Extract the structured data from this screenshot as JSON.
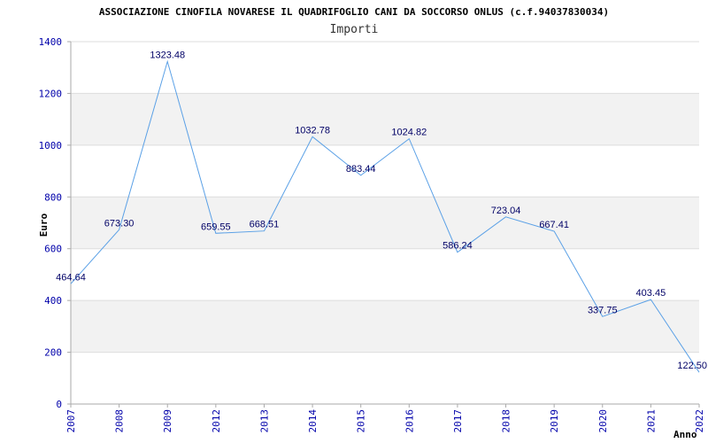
{
  "chart_data": {
    "type": "line",
    "title": "ASSOCIAZIONE CINOFILA NOVARESE IL QUADRIFOGLIO CANI DA SOCCORSO ONLUS (c.f.94037830034)",
    "subtitle": "Importi",
    "xlabel": "Anno",
    "ylabel": "Euro",
    "categories": [
      "2007",
      "2008",
      "2009",
      "2012",
      "2013",
      "2014",
      "2015",
      "2016",
      "2017",
      "2018",
      "2019",
      "2020",
      "2021",
      "2022"
    ],
    "series": [
      {
        "values": [
          464.64,
          673.3,
          1323.48,
          659.55,
          668.51,
          1032.78,
          883.44,
          1024.82,
          586.24,
          723.04,
          667.41,
          337.75,
          403.45,
          122.5
        ],
        "labels": [
          "464.64",
          "673.30",
          "1323.48",
          "659.55",
          "668.51",
          "1032.78",
          "883.44",
          "1024.82",
          "586.24",
          "723.04",
          "667.41",
          "337.75",
          "403.45",
          "122.50"
        ]
      }
    ],
    "ylim": [
      0,
      1400
    ],
    "yticks": [
      "0",
      "200",
      "400",
      "600",
      "800",
      "1000",
      "1200",
      "1400"
    ],
    "grid": true,
    "line_color": "#5aa0e6",
    "band_color": "#f2f2f2",
    "tick_color": "#0000aa",
    "label_color": "#000066"
  }
}
